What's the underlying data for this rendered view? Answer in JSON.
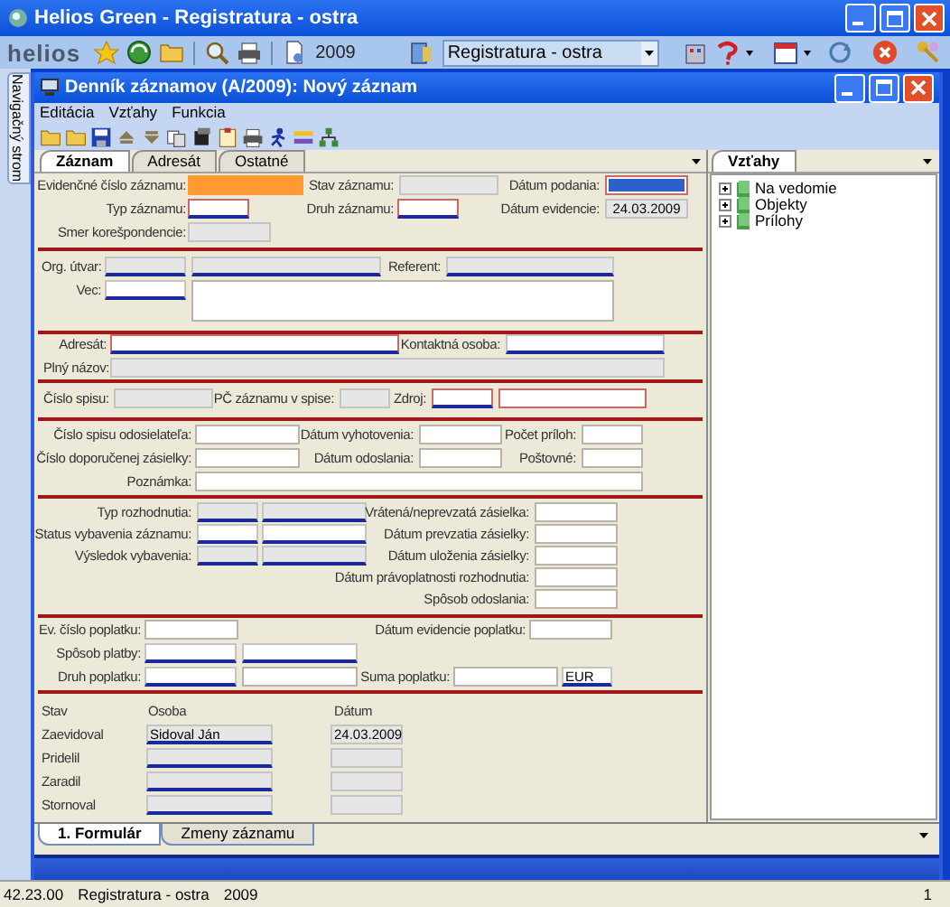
{
  "window": {
    "title": "Helios Green - Registratura - ostra"
  },
  "toolbar": {
    "logo": "helios",
    "year": "2009",
    "module": "Registratura - ostra"
  },
  "navigator": {
    "label": "Navigačný strom"
  },
  "document": {
    "title": "Denník záznamov (A/2009): Nový záznam",
    "menu": [
      "Editácia",
      "Vzťahy",
      "Funkcia"
    ],
    "tabs": [
      {
        "label": "Záznam",
        "selected": true
      },
      {
        "label": "Adresát",
        "selected": false
      },
      {
        "label": "Ostatné",
        "selected": false
      }
    ],
    "sections": [
      [
        [
          {
            "kind": "label",
            "text": "Evidenčné číslo záznamu:"
          },
          {
            "kind": "focus"
          },
          {
            "kind": "label",
            "text": "Stav záznamu:"
          },
          {
            "kind": "disabled"
          },
          {
            "kind": "label",
            "text": "Dátum podania:"
          },
          {
            "kind": "selected"
          }
        ],
        [
          {
            "kind": "label",
            "text": "Typ záznamu:"
          },
          {
            "kind": "required-lookup"
          },
          {
            "kind": "label",
            "text": "Druh záznamu:"
          },
          {
            "kind": "required-lookup"
          },
          {
            "kind": "label",
            "text": "Dátum evidencie:"
          },
          {
            "kind": "disabled",
            "value": "24.03.2009"
          }
        ],
        [
          {
            "kind": "label",
            "text": "Smer korešpondencie:"
          },
          {
            "kind": "disabled"
          }
        ]
      ],
      [
        [
          {
            "kind": "label",
            "text": "Org. útvar:"
          },
          {
            "kind": "disabled-lookup"
          },
          {
            "kind": "disabled-lookup"
          },
          {
            "kind": "label",
            "text": "Referent:"
          },
          {
            "kind": "disabled-lookup"
          }
        ],
        [
          {
            "kind": "label",
            "text": "Vec:"
          },
          {
            "kind": "lookup"
          },
          {
            "kind": "textarea"
          }
        ]
      ],
      [
        [
          {
            "kind": "label",
            "text": "Adresát:"
          },
          {
            "kind": "required-lookup"
          },
          {
            "kind": "label",
            "text": "Kontaktná osoba:"
          },
          {
            "kind": "lookup"
          }
        ],
        [
          {
            "kind": "label",
            "text": "Plný názov:"
          },
          {
            "kind": "disabled"
          }
        ]
      ],
      [
        [
          {
            "kind": "label",
            "text": "Číslo spisu:"
          },
          {
            "kind": "disabled"
          },
          {
            "kind": "label",
            "text": "PČ záznamu v spise:"
          },
          {
            "kind": "disabled"
          },
          {
            "kind": "label",
            "text": "Zdroj:"
          },
          {
            "kind": "required-lookup"
          },
          {
            "kind": "required"
          }
        ]
      ],
      [
        [
          {
            "kind": "label",
            "text": "Číslo spisu odosielateľa:"
          },
          {
            "kind": "plain"
          },
          {
            "kind": "label",
            "text": "Dátum vyhotovenia:"
          },
          {
            "kind": "plain"
          },
          {
            "kind": "label",
            "text": "Počet príloh:"
          },
          {
            "kind": "plain"
          }
        ],
        [
          {
            "kind": "label",
            "text": "Číslo doporučenej zásielky:"
          },
          {
            "kind": "plain"
          },
          {
            "kind": "label",
            "text": "Dátum odoslania:"
          },
          {
            "kind": "plain"
          },
          {
            "kind": "label",
            "text": "Poštovné:"
          },
          {
            "kind": "plain"
          }
        ],
        [
          {
            "kind": "label",
            "text": "Poznámka:"
          },
          {
            "kind": "plain"
          }
        ]
      ],
      [
        [
          {
            "kind": "label",
            "text": "Typ rozhodnutia:"
          },
          {
            "kind": "disabled-lookup"
          },
          {
            "kind": "disabled-lookup"
          },
          {
            "kind": "label",
            "text": "Vrátená/neprevzatá zásielka:"
          },
          {
            "kind": "plain"
          }
        ],
        [
          {
            "kind": "label",
            "text": "Status vybavenia záznamu:"
          },
          {
            "kind": "lookup"
          },
          {
            "kind": "lookup"
          },
          {
            "kind": "label",
            "text": "Dátum prevzatia zásielky:"
          },
          {
            "kind": "plain"
          }
        ],
        [
          {
            "kind": "label",
            "text": "Výsledok vybavenia:"
          },
          {
            "kind": "disabled-lookup"
          },
          {
            "kind": "disabled-lookup"
          },
          {
            "kind": "label",
            "text": "Dátum uloženia zásielky:"
          },
          {
            "kind": "plain"
          }
        ],
        [
          {
            "kind": "label",
            "text": "Dátum právoplatnosti rozhodnutia:"
          },
          {
            "kind": "plain"
          }
        ],
        [
          {
            "kind": "label",
            "text": "Spôsob odoslania:"
          },
          {
            "kind": "plain"
          }
        ]
      ],
      [
        [
          {
            "kind": "label",
            "text": "Ev. číslo poplatku:"
          },
          {
            "kind": "plain"
          },
          {
            "kind": "label",
            "text": "Dátum evidencie poplatku:"
          },
          {
            "kind": "plain"
          }
        ],
        [
          {
            "kind": "label",
            "text": "Spôsob platby:"
          },
          {
            "kind": "lookup"
          },
          {
            "kind": "lookup"
          }
        ],
        [
          {
            "kind": "label",
            "text": "Druh poplatku:"
          },
          {
            "kind": "lookup"
          },
          {
            "kind": "plain"
          },
          {
            "kind": "label",
            "text": "Suma poplatku:"
          },
          {
            "kind": "plain"
          },
          {
            "kind": "lookup",
            "value": "EUR"
          }
        ]
      ],
      [
        [
          {
            "kind": "label",
            "text": "Stav"
          },
          {
            "kind": "label",
            "text": "Osoba"
          },
          {
            "kind": "label",
            "text": "Dátum"
          }
        ],
        [
          {
            "kind": "label",
            "text": "Zaevidoval"
          },
          {
            "kind": "disabled-lookup",
            "value": "Sidoval Ján"
          },
          {
            "kind": "disabled",
            "value": "24.03.2009"
          }
        ],
        [
          {
            "kind": "label",
            "text": "Pridelil"
          },
          {
            "kind": "disabled-lookup"
          },
          {
            "kind": "disabled"
          }
        ],
        [
          {
            "kind": "label",
            "text": "Zaradil"
          },
          {
            "kind": "disabled-lookup"
          },
          {
            "kind": "disabled"
          }
        ],
        [
          {
            "kind": "label",
            "text": "Stornoval"
          },
          {
            "kind": "disabled-lookup"
          },
          {
            "kind": "disabled"
          }
        ]
      ]
    ],
    "relations": {
      "tabs": [
        {
          "label": "Vzťahy",
          "selected": true
        }
      ],
      "tree": [
        {
          "label": "Na vedomie",
          "expanded": false
        },
        {
          "label": "Objekty",
          "expanded": false
        },
        {
          "label": "Prílohy",
          "expanded": false
        }
      ]
    },
    "bottom_tabs": [
      {
        "label": "1. Formulár",
        "selected": true
      },
      {
        "label": "Zmeny záznamu",
        "selected": false
      }
    ]
  },
  "status_bar": [
    "42.23.00",
    "Registratura - ostra",
    "2009",
    "1"
  ]
}
